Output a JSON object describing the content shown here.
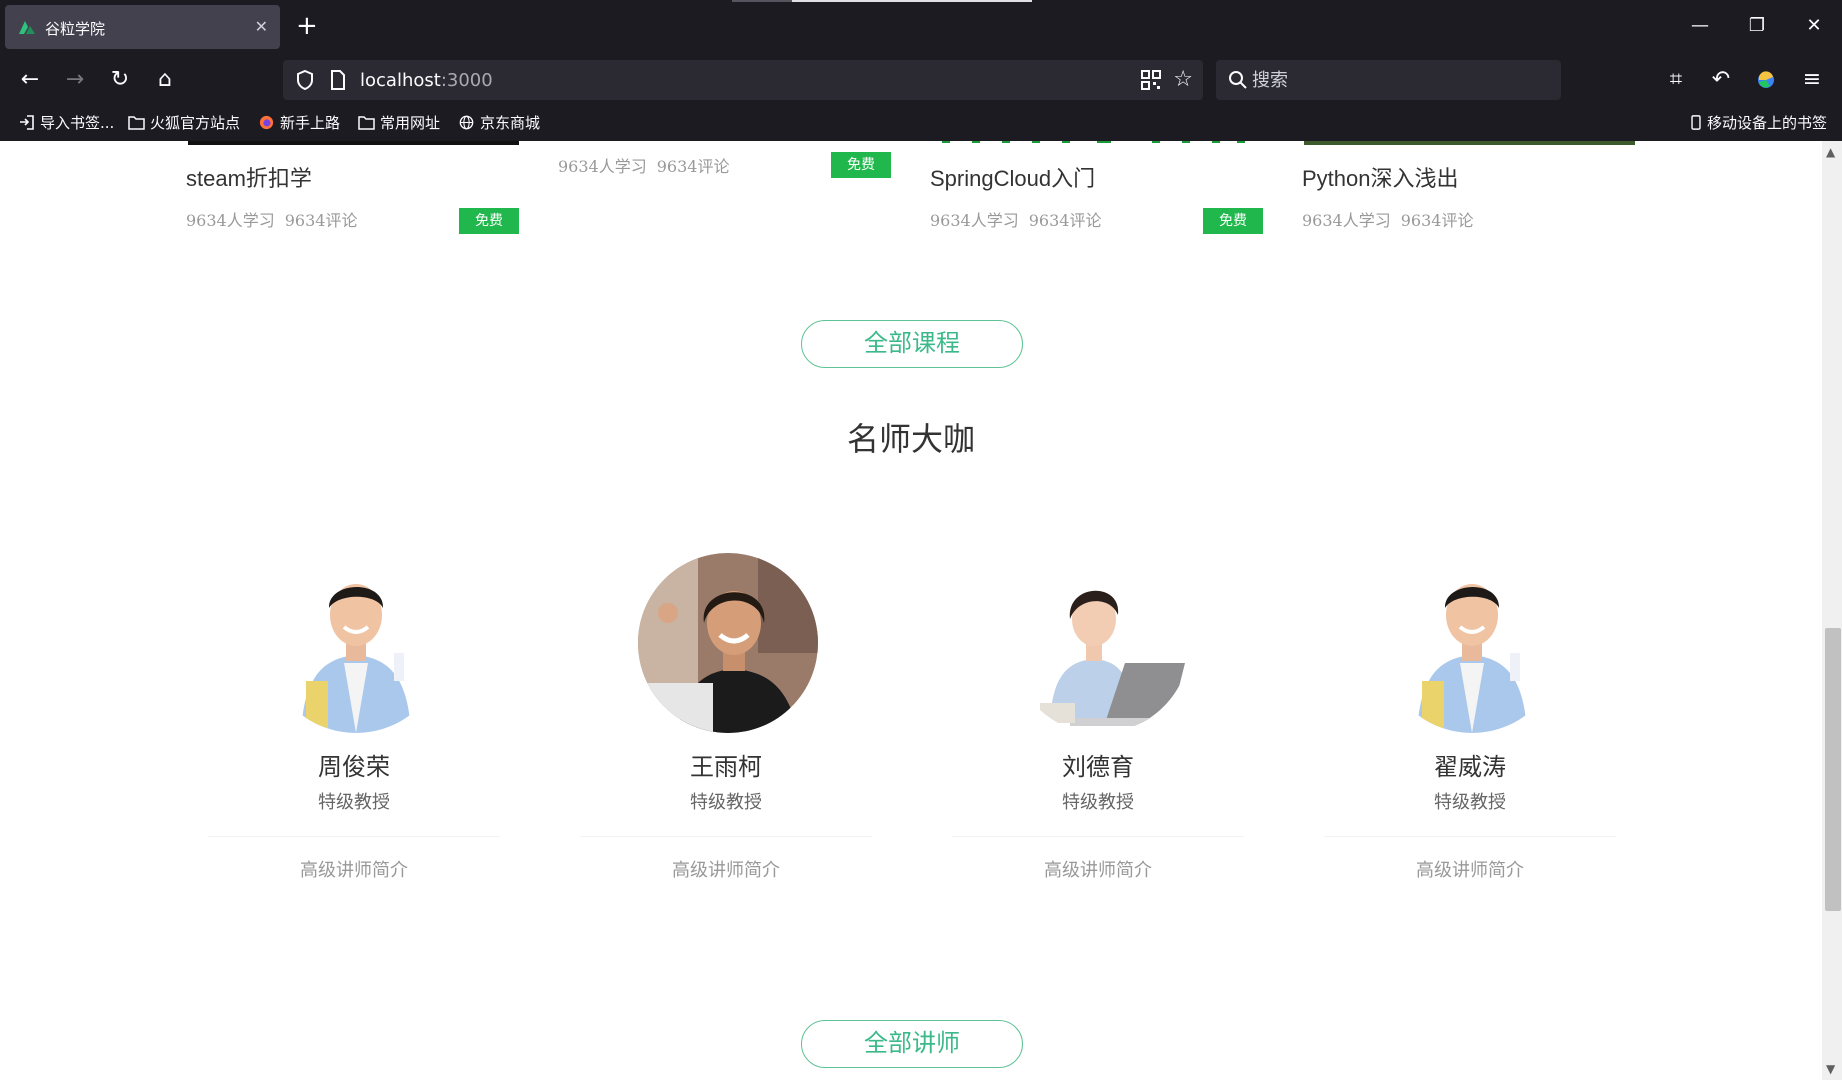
{
  "browser": {
    "tab_title": "谷粒学院",
    "url_host": "localhost",
    "url_port": ":3000",
    "search_placeholder": "搜索",
    "bookmarks": [
      "导入书签...",
      "火狐官方站点",
      "新手上路",
      "常用网址",
      "京东商城"
    ],
    "mobile_bookmarks": "移动设备上的书签"
  },
  "courses": [
    {
      "title": "steam折扣学",
      "students": "9634人学习",
      "comments": "9634评论",
      "badge": "免费"
    },
    {
      "title": "",
      "students": "9634人学习",
      "comments": "9634评论",
      "badge": "免费"
    },
    {
      "title": "SpringCloud入门",
      "students": "9634人学习",
      "comments": "9634评论",
      "badge": "免费"
    },
    {
      "title": "Python深入浅出",
      "students": "9634人学习",
      "comments": "9634评论",
      "badge": ""
    }
  ],
  "all_courses_button": "全部课程",
  "teachers_section": {
    "title": "名师大咖",
    "teachers": [
      {
        "name": "周俊荣",
        "rank": "特级教授",
        "intro": "高级讲师简介"
      },
      {
        "name": "王雨柯",
        "rank": "特级教授",
        "intro": "高级讲师简介"
      },
      {
        "name": "刘德育",
        "rank": "特级教授",
        "intro": "高级讲师简介"
      },
      {
        "name": "翟威涛",
        "rank": "特级教授",
        "intro": "高级讲师简介"
      }
    ],
    "all_teachers_button": "全部讲师"
  },
  "colors": {
    "chrome_bg": "#1c1b22",
    "accent_green": "#20b84c",
    "outline_green": "#5fc296"
  }
}
